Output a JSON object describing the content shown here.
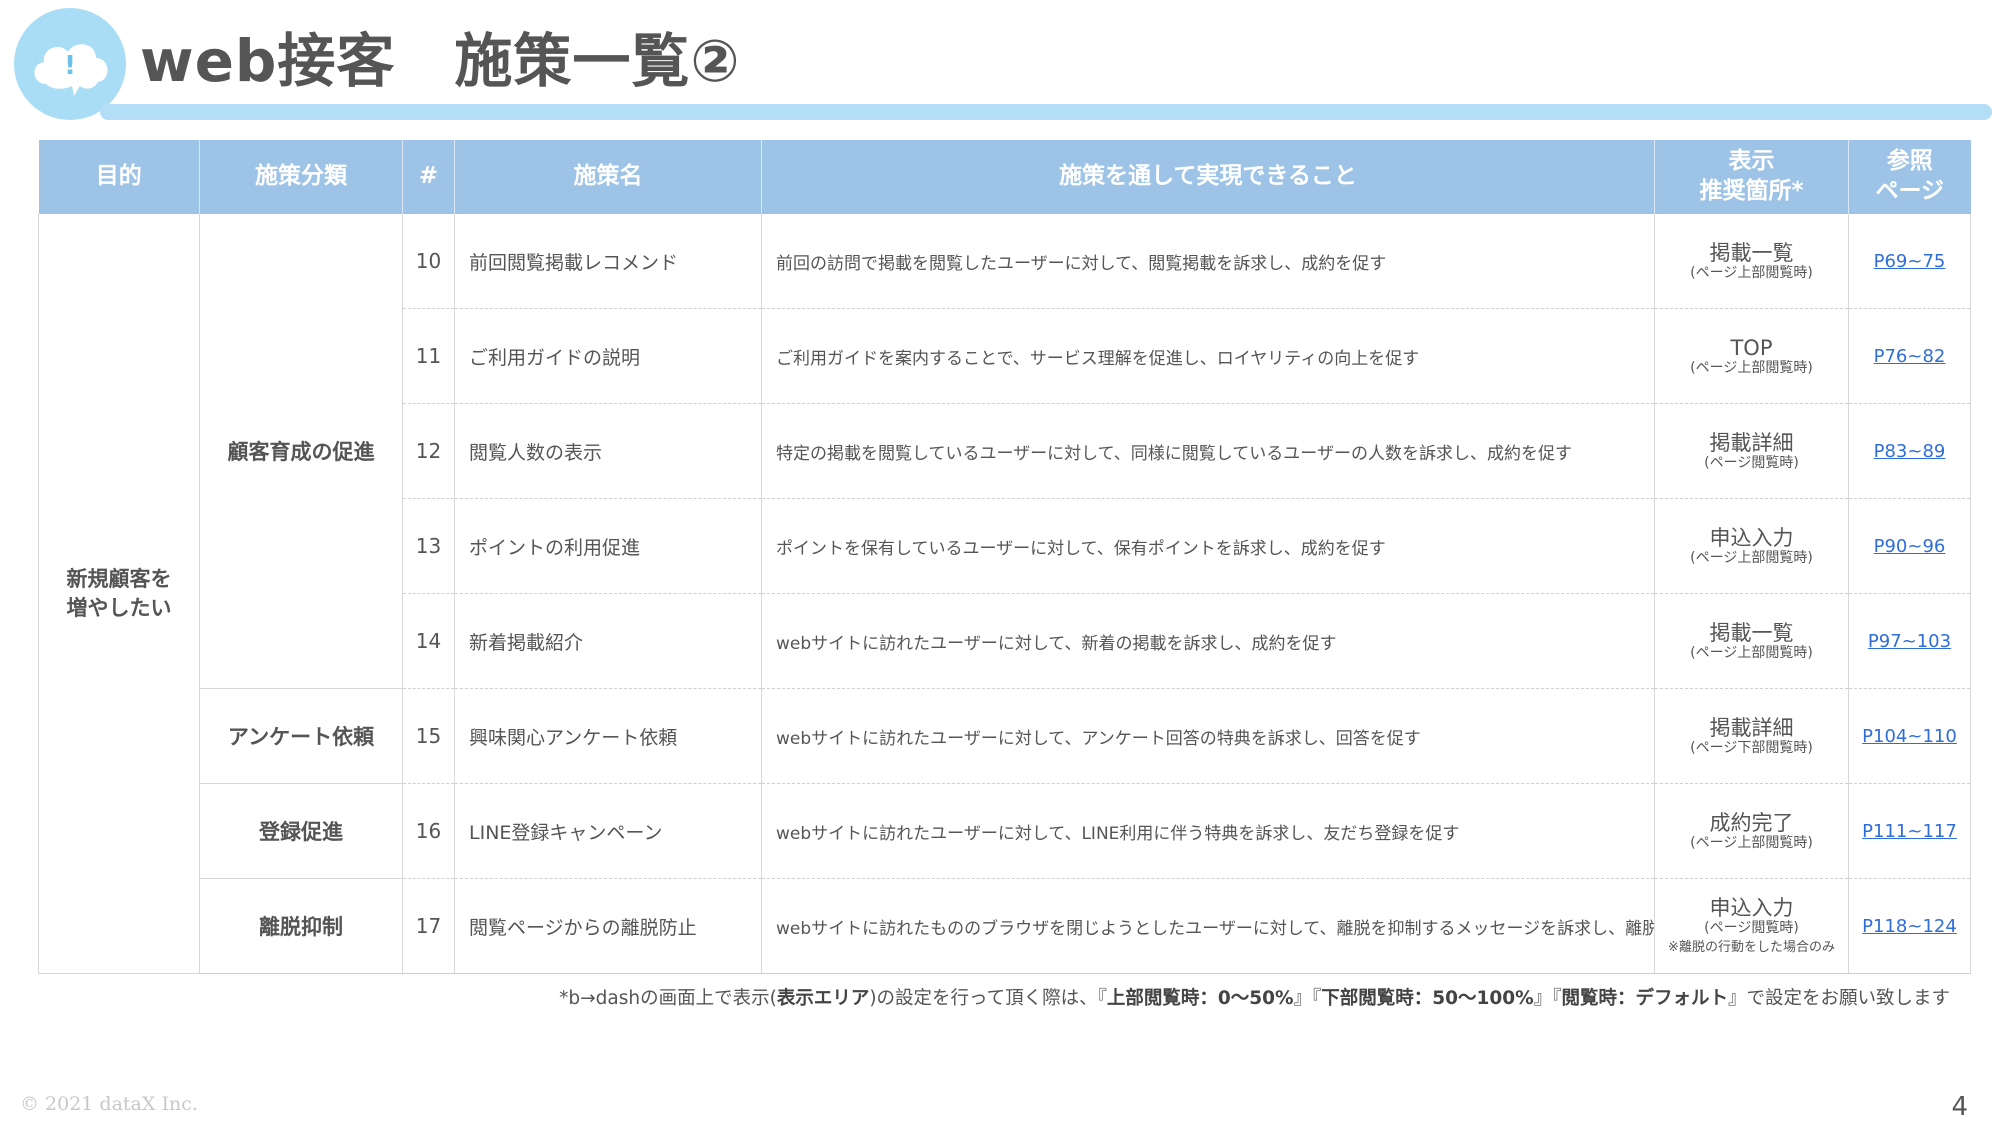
{
  "header": {
    "title": "web接客　施策一覧②"
  },
  "table": {
    "columns": [
      "目的",
      "施策分類",
      "#",
      "施策名",
      "施策を通して実現できること",
      "表示\n推奨箇所*",
      "参照\nページ"
    ],
    "purpose": "新規顧客を\n増やしたい",
    "categories": {
      "growth": "顧客育成の促進",
      "survey": "アンケート依頼",
      "register": "登録促進",
      "churn": "離脱抑制"
    },
    "rows": [
      {
        "num": "10",
        "name": "前回閲覧掲載レコメンド",
        "desc": "前回の訪問で掲載を閲覧したユーザーに対して、閲覧掲載を訴求し、成約を促す",
        "loc": "掲載一覧",
        "loc_sub": "(ページ上部閲覧時)",
        "ref": "P69~75"
      },
      {
        "num": "11",
        "name": "ご利用ガイドの説明",
        "desc": "ご利用ガイドを案内することで、サービス理解を促進し、ロイヤリティの向上を促す",
        "loc": "TOP",
        "loc_sub": "(ページ上部閲覧時)",
        "ref": "P76~82"
      },
      {
        "num": "12",
        "name": "閲覧人数の表示",
        "desc": "特定の掲載を閲覧しているユーザーに対して、同様に閲覧しているユーザーの人数を訴求し、成約を促す",
        "loc": "掲載詳細",
        "loc_sub": "(ページ閲覧時)",
        "ref": "P83~89"
      },
      {
        "num": "13",
        "name": "ポイントの利用促進",
        "desc": "ポイントを保有しているユーザーに対して、保有ポイントを訴求し、成約を促す",
        "loc": "申込入力",
        "loc_sub": "(ページ上部閲覧時)",
        "ref": "P90~96"
      },
      {
        "num": "14",
        "name": "新着掲載紹介",
        "desc": "webサイトに訪れたユーザーに対して、新着の掲載を訴求し、成約を促す",
        "loc": "掲載一覧",
        "loc_sub": "(ページ上部閲覧時)",
        "ref": "P97~103"
      },
      {
        "num": "15",
        "name": "興味関心アンケート依頼",
        "desc": "webサイトに訪れたユーザーに対して、アンケート回答の特典を訴求し、回答を促す",
        "loc": "掲載詳細",
        "loc_sub": "(ページ下部閲覧時)",
        "ref": "P104~110"
      },
      {
        "num": "16",
        "name": "LINE登録キャンペーン",
        "desc": "webサイトに訪れたユーザーに対して、LINE利用に伴う特典を訴求し、友だち登録を促す",
        "loc": "成約完了",
        "loc_sub": "(ページ上部閲覧時)",
        "ref": "P111~117"
      },
      {
        "num": "17",
        "name": "閲覧ページからの離脱防止",
        "desc": "webサイトに訪れたもののブラウザを閉じようとしたユーザーに対して、離脱を抑制するメッセージを訴求し、離脱防止を促す",
        "loc": "申込入力",
        "loc_sub": "(ページ閲覧時)",
        "loc_note": "※離脱の行動をした場合のみ",
        "ref": "P118~124"
      }
    ]
  },
  "footnote": {
    "t1": "*b→dashの画面上で表示(",
    "b1": "表示エリア",
    "t2": ")の設定を行って頂く際は、『",
    "b2": "上部閲覧時：0～50%",
    "t3": "』『",
    "b3": "下部閲覧時：50～100%",
    "t4": "』『",
    "b4": "閲覧時：デフォルト",
    "t5": "』で設定をお願い致します"
  },
  "copyright": "© 2021 dataX Inc.",
  "page_number": "4",
  "colors": {
    "header_bg": "#9dc3e6",
    "accent_light": "#b3def6",
    "link": "#2f6ed8"
  }
}
